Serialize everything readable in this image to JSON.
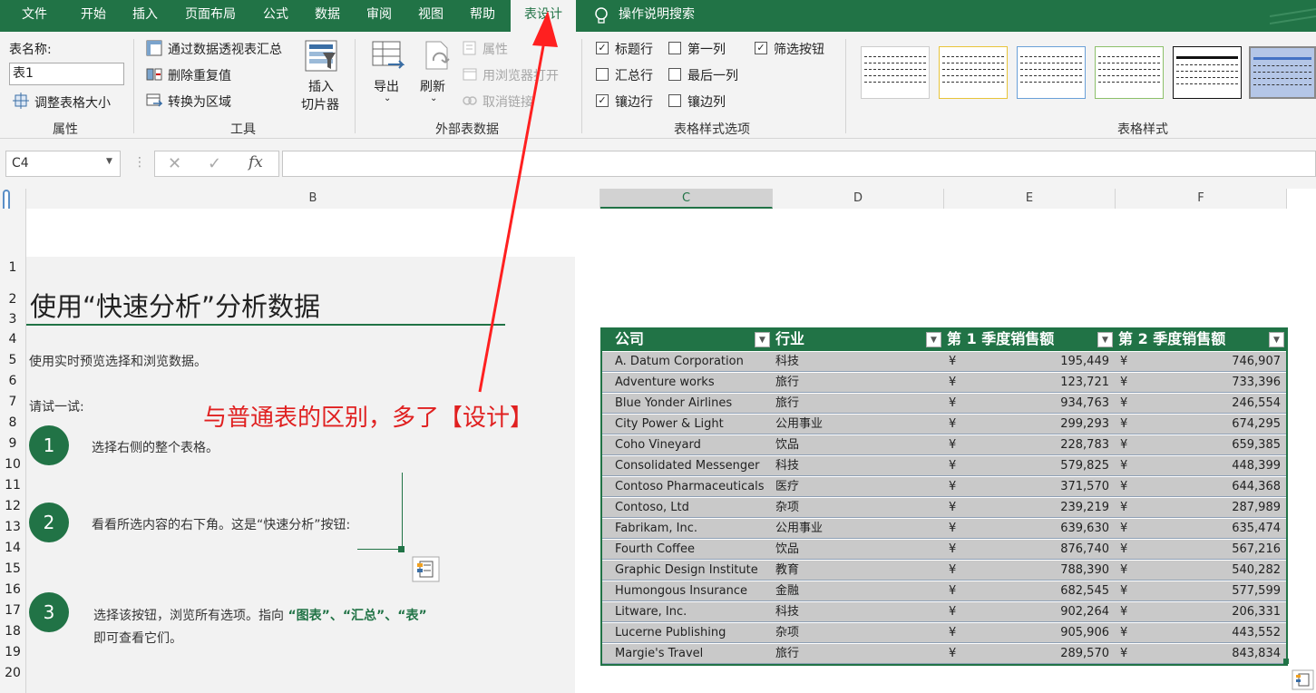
{
  "tabs": [
    "文件",
    "开始",
    "插入",
    "页面布局",
    "公式",
    "数据",
    "审阅",
    "视图",
    "帮助",
    "表设计"
  ],
  "tell_me": "操作说明搜索",
  "ribbon": {
    "props": {
      "table_name_label": "表名称:",
      "table_name_value": "表1",
      "resize": "调整表格大小",
      "group": "属性"
    },
    "tools": {
      "pivot": "通过数据透视表汇总",
      "dedupe": "删除重复值",
      "convert": "转换为区域",
      "slicer_1": "插入",
      "slicer_2": "切片器",
      "group": "工具"
    },
    "external": {
      "export": "导出",
      "refresh": "刷新",
      "properties": "属性",
      "open_browser": "用浏览器打开",
      "unlink": "取消链接",
      "group": "外部表数据"
    },
    "style_options": {
      "header_row": "标题行",
      "first_col": "第一列",
      "filter_btn": "筛选按钮",
      "total_row": "汇总行",
      "last_col": "最后一列",
      "banded_rows": "镶边行",
      "banded_cols": "镶边列",
      "group": "表格样式选项"
    },
    "styles_group": "表格样式"
  },
  "namebox": "C4",
  "columns": {
    "B": "B",
    "C": "C",
    "D": "D",
    "E": "E",
    "F": "F"
  },
  "rows": [
    "1",
    "2",
    "3",
    "4",
    "5",
    "6",
    "7",
    "8",
    "9",
    "10",
    "11",
    "12",
    "13",
    "14",
    "15",
    "16",
    "17",
    "18",
    "19",
    "20"
  ],
  "panel": {
    "title": "使用“快速分析”分析数据",
    "subtitle": "使用实时预览选择和浏览数据。",
    "try": "请试一试:",
    "step1_num": "1",
    "step1": "选择右侧的整个表格。",
    "step2_num": "2",
    "step2": "看看所选内容的右下角。这是“快速分析”按钮:",
    "step3_num": "3",
    "step3_a": "选择该按钮，浏览所有选项。指向 ",
    "step3_b": "“图表”、“汇总”、“表”",
    "step3_c": "即可查看它们。"
  },
  "annotation": "与普通表的区别，多了【设计】",
  "table": {
    "headers": [
      "公司",
      "行业",
      "第 1 季度销售额",
      "第 2 季度销售额"
    ],
    "currency": "¥",
    "rows": [
      [
        "A. Datum Corporation",
        "科技",
        "195,449",
        "746,907"
      ],
      [
        "Adventure works",
        "旅行",
        "123,721",
        "733,396"
      ],
      [
        "Blue Yonder Airlines",
        "旅行",
        "934,763",
        "246,554"
      ],
      [
        "City Power & Light",
        "公用事业",
        "299,293",
        "674,295"
      ],
      [
        "Coho Vineyard",
        "饮品",
        "228,783",
        "659,385"
      ],
      [
        "Consolidated Messenger",
        "科技",
        "579,825",
        "448,399"
      ],
      [
        "Contoso Pharmaceuticals",
        "医疗",
        "371,570",
        "644,368"
      ],
      [
        "Contoso, Ltd",
        "杂项",
        "239,219",
        "287,989"
      ],
      [
        "Fabrikam, Inc.",
        "公用事业",
        "639,630",
        "635,474"
      ],
      [
        "Fourth Coffee",
        "饮品",
        "876,740",
        "567,216"
      ],
      [
        "Graphic Design Institute",
        "教育",
        "788,390",
        "540,282"
      ],
      [
        "Humongous Insurance",
        "金融",
        "682,545",
        "577,599"
      ],
      [
        "Litware, Inc.",
        "科技",
        "902,264",
        "206,331"
      ],
      [
        "Lucerne Publishing",
        "杂项",
        "905,906",
        "443,552"
      ],
      [
        "Margie's Travel",
        "旅行",
        "289,570",
        "843,834"
      ]
    ]
  }
}
